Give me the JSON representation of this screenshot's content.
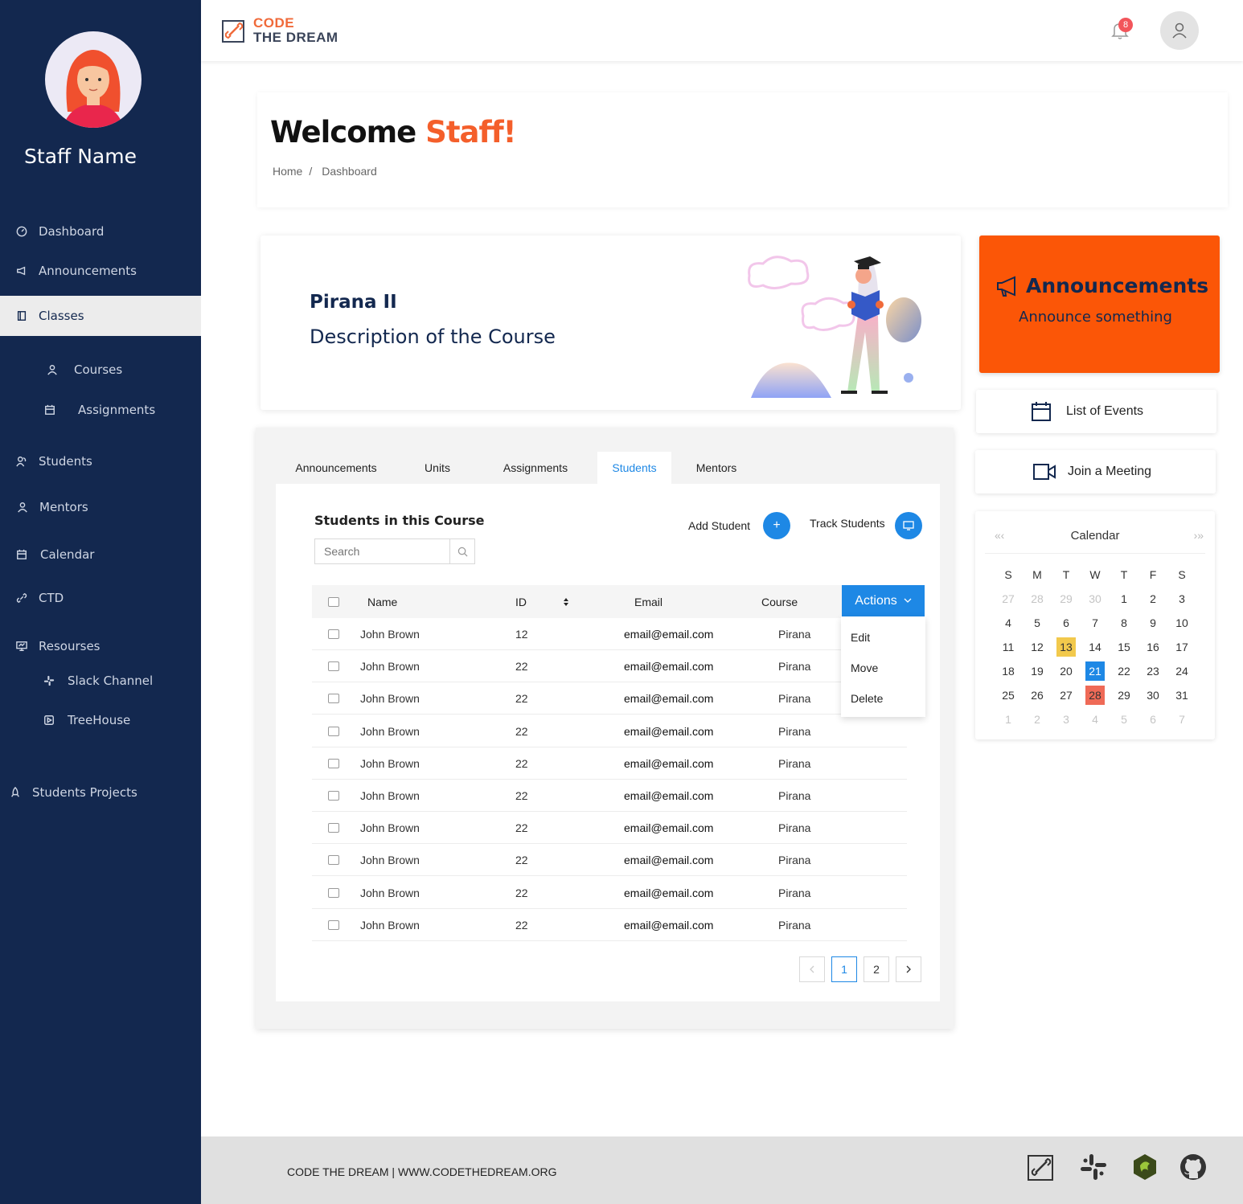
{
  "sidebar": {
    "user_name": "Staff Name",
    "items": [
      {
        "label": "Dashboard"
      },
      {
        "label": "Announcements"
      },
      {
        "label": "Classes"
      },
      {
        "label": "Courses"
      },
      {
        "label": "Assignments"
      },
      {
        "label": "Students"
      },
      {
        "label": "Mentors"
      },
      {
        "label": "Calendar"
      },
      {
        "label": "CTD"
      },
      {
        "label": "Resourses"
      },
      {
        "label": "Slack Channel"
      },
      {
        "label": "TreeHouse"
      },
      {
        "label": "Students Projects"
      }
    ]
  },
  "header": {
    "logo_line1": "CODE",
    "logo_line2": "THE DREAM",
    "notification_count": "8"
  },
  "welcome": {
    "title": "Welcome",
    "title_accent": "Staff!",
    "breadcrumb": [
      "Home",
      "/",
      "Dashboard"
    ]
  },
  "course": {
    "title": "Pirana II",
    "description": "Description of the Course"
  },
  "announcements_card": {
    "title": "Announcements",
    "subtitle": "Announce something"
  },
  "side_buttons": {
    "events": "List of Events",
    "meeting": "Join a Meeting"
  },
  "calendar": {
    "title": "Calendar",
    "nav_prev": "« ‹",
    "nav_next": "› »",
    "weekdays": [
      "S",
      "M",
      "T",
      "W",
      "T",
      "F",
      "S"
    ],
    "days": [
      "27",
      "28",
      "29",
      "30",
      "1",
      "2",
      "3",
      "4",
      "5",
      "6",
      "7",
      "8",
      "9",
      "10",
      "11",
      "12",
      "13",
      "14",
      "15",
      "16",
      "17",
      "18",
      "19",
      "20",
      "21",
      "22",
      "23",
      "24",
      "25",
      "26",
      "27",
      "28",
      "29",
      "30",
      "31",
      "1",
      "2",
      "3",
      "4",
      "5",
      "6",
      "7"
    ],
    "dim_indices": [
      0,
      1,
      2,
      3,
      35,
      36,
      37,
      38,
      39,
      40,
      41
    ],
    "highlight_yellow": 16,
    "highlight_blue": 24,
    "highlight_red": 31
  },
  "tabs": [
    "Announcements",
    "Units",
    "Assignments",
    "Students",
    "Mentors"
  ],
  "active_tab": "Students",
  "students": {
    "title": "Students in this Course",
    "search_placeholder": "Search",
    "add_label": "Add Student",
    "track_label": "Track Students",
    "columns": [
      "Name",
      "ID",
      "Email",
      "Course"
    ],
    "actions_label": "Actions",
    "actions_menu": [
      "Edit",
      "Move",
      "Delete"
    ],
    "rows": [
      {
        "name": "John Brown",
        "id": "12",
        "email": "email@email.com",
        "course": "Pirana"
      },
      {
        "name": "John Brown",
        "id": "22",
        "email": "email@email.com",
        "course": "Pirana"
      },
      {
        "name": "John Brown",
        "id": "22",
        "email": "email@email.com",
        "course": "Pirana"
      },
      {
        "name": "John Brown",
        "id": "22",
        "email": "email@email.com",
        "course": "Pirana"
      },
      {
        "name": "John Brown",
        "id": "22",
        "email": "email@email.com",
        "course": "Pirana"
      },
      {
        "name": "John Brown",
        "id": "22",
        "email": "email@email.com",
        "course": "Pirana"
      },
      {
        "name": "John Brown",
        "id": "22",
        "email": "email@email.com",
        "course": "Pirana"
      },
      {
        "name": "John Brown",
        "id": "22",
        "email": "email@email.com",
        "course": "Pirana"
      },
      {
        "name": "John Brown",
        "id": "22",
        "email": "email@email.com",
        "course": "Pirana"
      },
      {
        "name": "John Brown",
        "id": "22",
        "email": "email@email.com",
        "course": "Pirana"
      }
    ],
    "pages": [
      "1",
      "2"
    ],
    "current_page": "1"
  },
  "footer": {
    "text": "CODE THE DREAM | WWW.CODETHEDREAM.ORG",
    "icons": [
      "ctd-logo-icon",
      "slack-icon",
      "treehouse-icon",
      "github-icon"
    ]
  },
  "colors": {
    "sidebar_bg": "#13284f",
    "accent_orange": "#fb5607",
    "primary_blue": "#1e88e5"
  }
}
